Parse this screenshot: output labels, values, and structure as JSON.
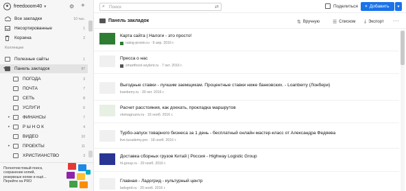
{
  "sidebar": {
    "username": "freedooom40",
    "all_bookmarks": {
      "label": "Все закладки",
      "count": "10 тыс."
    },
    "unsorted": {
      "label": "Несортированные",
      "count": "1"
    },
    "trash": {
      "label": "Корзина",
      "count": "2"
    },
    "collections_header": "Коллекции",
    "collections": [
      {
        "label": "Полезные сайты",
        "count": "1"
      },
      {
        "label": "Панель закладок",
        "count": "97"
      }
    ],
    "subfolders": [
      {
        "label": "ПОГОДА",
        "count": "3",
        "caret": ""
      },
      {
        "label": "ПОЧТА",
        "count": "7",
        "caret": ""
      },
      {
        "label": "СЕТЬ",
        "count": "8",
        "caret": ""
      },
      {
        "label": "УСЛУГИ",
        "count": "6",
        "caret": ""
      },
      {
        "label": "ФИНАНСЫ",
        "count": "7",
        "caret": "▸"
      },
      {
        "label": "Р Ы Н О К",
        "count": "4",
        "caret": "▸"
      },
      {
        "label": "ВИДЕО",
        "count": "10",
        "caret": ""
      },
      {
        "label": "ПРОЕКТЫ",
        "count": "11",
        "caret": "▸"
      },
      {
        "label": "ХРИСТИАНСТВО",
        "count": "3",
        "caret": ""
      }
    ],
    "promo": {
      "line1": "Полнотекстовый поиск,",
      "line2": "сохранение копий,",
      "line3": "резервные копии и ещё...",
      "link": "Перейти на PRO"
    }
  },
  "header": {
    "search_placeholder": "Поиск",
    "share_label": "Поделиться",
    "add_label": "Добавить",
    "add_plus": "+"
  },
  "toolbar": {
    "title": "Панель закладок",
    "sort_label": "Вручную",
    "view_label": "Списком",
    "export_label": "Экспорт",
    "more": "···"
  },
  "bookmarks": [
    {
      "title": "Карта сайта | Налоги - это просто!",
      "domain": "nalog-prosto.ru",
      "date": "9 апр. 2016 г."
    },
    {
      "title": "Пресса о нас",
      "domain": "smartfoost-soylent.ru",
      "date": "7 окт. 2016 г."
    },
    {
      "title": "Выгодные ставки - лучшим заемщикам. Процентные ставки ниже банковских. - Loanberry (Лонбери)",
      "domain": "loanberry.ru",
      "date": "30 окт. 2016 г."
    },
    {
      "title": "Расчет расстояния, как доехать, прокладка маршрутов",
      "domain": "vtomagruzov.ru",
      "date": "16 нояб. 2016 г."
    },
    {
      "title": "Турбо-запуск товарного бизнеса за 1 день - бесплатный онлайн мастер-класс от Александра Федяева",
      "domain": "live.tucademy.pro",
      "date": "18 нояб. 2016 г."
    },
    {
      "title": "Доставка сборных грузов Китай | Россия - Highway Logistic Group",
      "domain": "hl-group.ru",
      "date": "20 нояб. 2016 г."
    },
    {
      "title": "Главная - Ладогрид - культурный центр",
      "domain": "ladogrid.ru",
      "date": "20 нояб. 2016 г."
    }
  ],
  "colors": {
    "accent": "#1a73e8",
    "sidebar_bg": "#f6f6f6",
    "active_row": "#e3e3e3"
  }
}
